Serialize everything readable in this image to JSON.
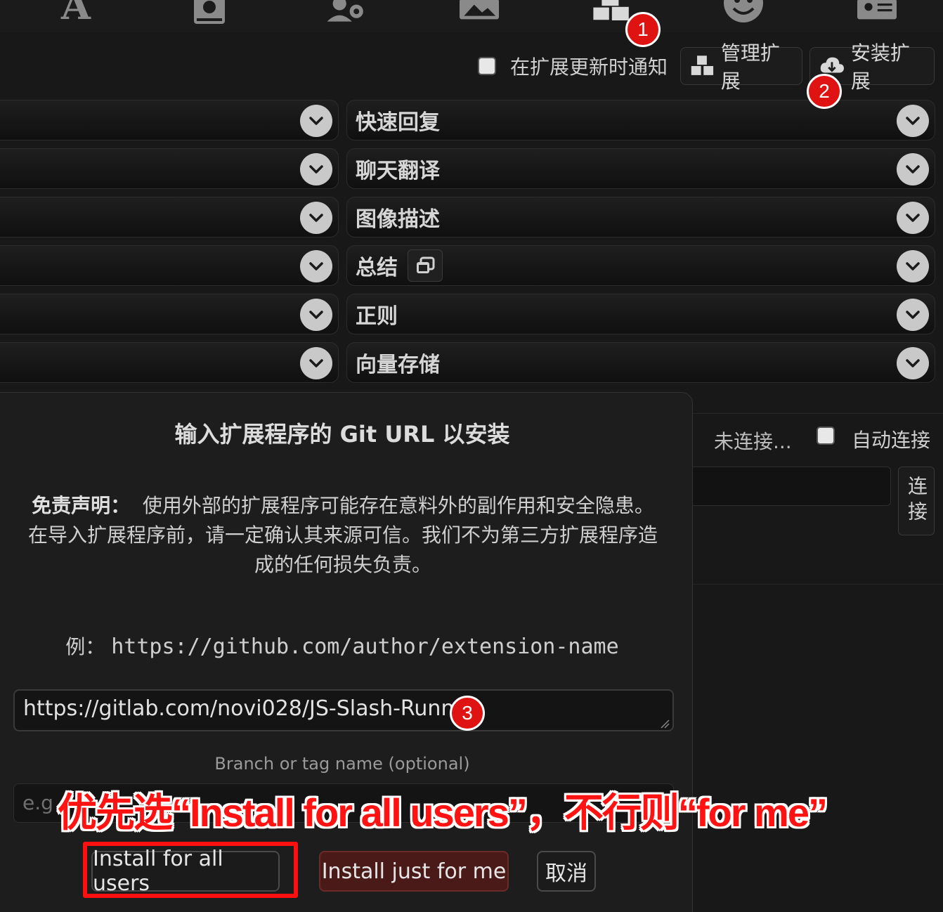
{
  "topbar": {
    "icons": [
      "text-format-icon",
      "book-icon",
      "user-settings-icon",
      "image-icon",
      "extensions-cubes-icon",
      "smiley-icon",
      "id-card-icon"
    ],
    "active": "extensions-cubes-icon"
  },
  "toolbar": {
    "notify_label": "在扩展更新时通知",
    "manage_label": "管理扩展",
    "install_label": "安装扩展"
  },
  "drawers": {
    "right": [
      "快速回复",
      "聊天翻译",
      "图像描述",
      "总结",
      "正则",
      "向量存储"
    ]
  },
  "connection": {
    "status": "未连接...",
    "auto_label": "自动连接",
    "connect_label": "连接"
  },
  "dialog": {
    "title": "输入扩展程序的 Git URL 以安装",
    "disclaimer_label": "免责声明：",
    "disclaimer_text": "使用外部的扩展程序可能存在意料外的副作用和安全隐患。在导入扩展程序前，请一定确认其来源可信。我们不为第三方扩展程序造成的任何损失负责。",
    "example_label": "例：",
    "example_url": "https://github.com/author/extension-name",
    "url_value": "https://gitlab.com/novi028/JS-Slash-Runner",
    "branch_label": "Branch or tag name (optional)",
    "branch_placeholder": "e.g",
    "install_all_label": "Install for all users",
    "install_me_label": "Install just for me",
    "cancel_label": "取消"
  },
  "annotations": {
    "badge1": "1",
    "badge2": "2",
    "badge3": "3",
    "note": "优先选“Install for all users”，不行则“for me”",
    "color": "#ff1212"
  }
}
